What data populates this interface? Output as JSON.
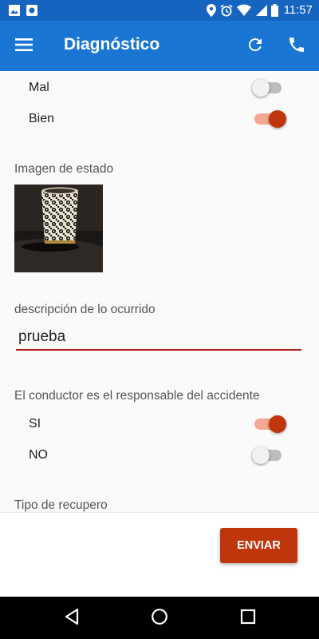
{
  "status_bar": {
    "time": "11:57",
    "left_icons": [
      "image-icon",
      "record-icon"
    ],
    "right_icons": [
      "location-icon",
      "alarm-icon",
      "wifi-icon",
      "signal-icon",
      "battery-icon"
    ]
  },
  "app_bar": {
    "title": "Diagnóstico",
    "color": "#1976d2",
    "status_color": "#1565c0",
    "icons": [
      "menu-icon",
      "refresh-icon",
      "phone-icon"
    ]
  },
  "form": {
    "condition_options": [
      {
        "label": "Mal",
        "checked": false
      },
      {
        "label": "Bien",
        "checked": true
      }
    ],
    "image_label": "Imagen de estado",
    "description_label": "descripción de lo ocurrido",
    "description_value": "prueba",
    "responsible_label": "El conductor es el responsable del accidente",
    "responsible_options": [
      {
        "label": "SI",
        "checked": true
      },
      {
        "label": "NO",
        "checked": false
      }
    ],
    "recovery_label": "Tipo de recupero"
  },
  "actions": {
    "send_label": "ENVIAR",
    "accent_color": "#bf360c"
  },
  "nav_bar": {
    "icons": [
      "back-icon",
      "home-icon",
      "recents-icon"
    ]
  }
}
